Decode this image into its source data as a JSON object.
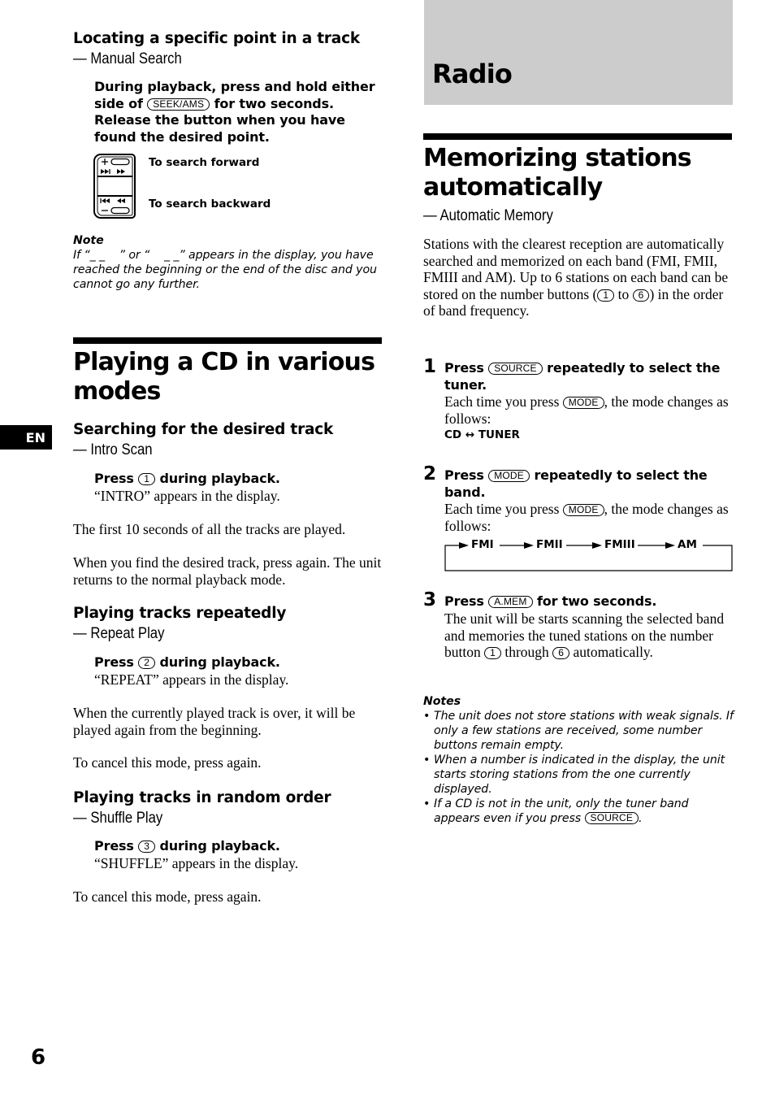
{
  "page": {
    "number": "6",
    "language_tab": "EN"
  },
  "left": {
    "manual_search": {
      "heading": "Locating a specific point in a track",
      "subheading": "— Manual Search",
      "instruction_pre": "During playback, press and hold either side of",
      "button": "SEEK/AMS",
      "instruction_post": "for two seconds. Release the button when you have found the desired point.",
      "icon": "seek-ams-button-illustration",
      "forward_label": "To search forward",
      "backward_label": "To search backward",
      "note_title": "Note",
      "note_text": "If “_ _    ” or “    _ _” appears in the display, you have reached the beginning or the end of the disc and you cannot go any further."
    },
    "cd_modes": {
      "title_line1": "Playing a CD in various",
      "title_line2": "modes",
      "intro_scan": {
        "heading": "Searching for the desired track",
        "subheading": "— Intro Scan",
        "press": "Press",
        "button": "1",
        "instruction_post": "during playback.",
        "display_text": "“INTRO” appears in the display.",
        "para1": "The first 10 seconds of all the tracks are played.",
        "para2": "When you find the desired track, press again. The unit returns to the normal playback mode."
      },
      "repeat": {
        "heading": "Playing tracks repeatedly",
        "subheading": "— Repeat Play",
        "press": "Press",
        "button": "2",
        "instruction_post": "during playback.",
        "display_text": "“REPEAT” appears in the display.",
        "para1": "When the currently played track is over, it will be played again from the beginning.",
        "para2": "To cancel this mode, press again."
      },
      "shuffle": {
        "heading": "Playing tracks in random order",
        "subheading": "— Shuffle Play",
        "press": "Press",
        "button": "3",
        "instruction_post": "during playback.",
        "display_text": "“SHUFFLE” appears in the display.",
        "para1": "To cancel this mode, press again."
      }
    }
  },
  "right": {
    "banner_title": "Radio",
    "section_title_line1": "Memorizing stations",
    "section_title_line2": "automatically",
    "subheading": "— Automatic Memory",
    "intro": {
      "text_pre": "Stations with the clearest reception are automatically searched and memorized on each band (FMI, FMII, FMIII and AM). Up to 6 stations on each band can be stored on the number buttons (",
      "btn_a": "1",
      "text_mid": " to ",
      "btn_b": "6",
      "text_post": ") in the order of band frequency."
    },
    "steps": [
      {
        "number": "1",
        "press": "Press",
        "button": "SOURCE",
        "instruction_post": "repeatedly to select the tuner.",
        "body_pre": "Each time you press",
        "body_button": "MODE",
        "body_post": ", the mode changes as follows:",
        "flow_from": "CD",
        "flow_arrow": "↔",
        "flow_to": "TUNER"
      },
      {
        "number": "2",
        "press": "Press",
        "button": "MODE",
        "instruction_post": "repeatedly to select the band.",
        "body_pre": "Each time you press",
        "body_button": "MODE",
        "body_post": ", the mode changes as follows:",
        "bands": [
          "FMI",
          "FMII",
          "FMIII",
          "AM"
        ]
      },
      {
        "number": "3",
        "press": "Press",
        "button": "A.MEM",
        "instruction_post": "for two seconds.",
        "body_pre": "The unit will be starts scanning the selected band and memories the tuned stations on the number button",
        "btn_a": "1",
        "body_mid": "through",
        "btn_b": "6",
        "body_post": "automatically."
      }
    ],
    "notes": {
      "title": "Notes",
      "items": [
        "The unit does not store stations with weak signals. If only a few stations are received, some number buttons remain empty.",
        "When a number is indicated in the display, the unit starts storing stations from the one currently displayed."
      ],
      "last_pre": "If a CD is not in the unit, only the tuner band appears even if you press",
      "last_button": "SOURCE",
      "last_post": "."
    }
  }
}
